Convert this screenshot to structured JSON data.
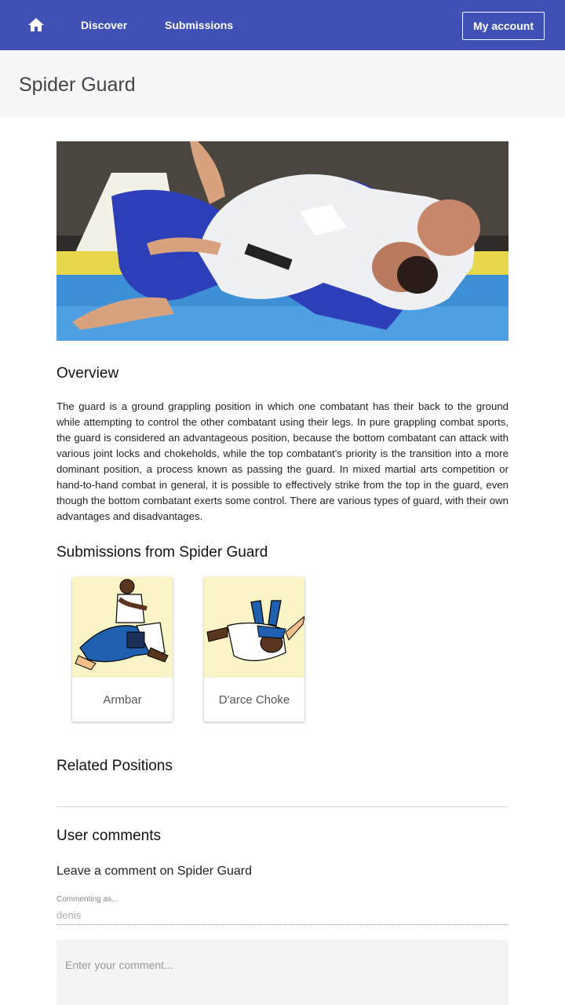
{
  "nav": {
    "home_icon": "home-icon",
    "discover": "Discover",
    "submissions": "Submissions",
    "account": "My account",
    "bar_color": "#3f51b5"
  },
  "page": {
    "title": "Spider Guard"
  },
  "overview": {
    "heading": "Overview",
    "text": "The guard is a ground grappling position in which one combatant has their back to the ground while attempting to control the other combatant using their legs. In pure grappling combat sports, the guard is considered an advantageous position, because the bottom combatant can attack with various joint locks and chokeholds, while the top combatant's priority is the transition into a more dominant position, a process known as passing the guard. In mixed martial arts competition or hand-to-hand combat in general, it is possible to effectively strike from the top in the guard, even though the bottom combatant exerts some control. There are various types of guard, with their own advantages and disadvantages."
  },
  "submissions": {
    "heading": "Submissions from Spider Guard",
    "items": [
      {
        "label": "Armbar"
      },
      {
        "label": "D'arce Choke"
      }
    ]
  },
  "related": {
    "heading": "Related Positions"
  },
  "comments": {
    "heading": "User comments",
    "leave": "Leave a comment on Spider Guard",
    "commenting_label": "Commenting as...",
    "commenting_value": "denis",
    "placeholder": "Enter your comment..."
  }
}
